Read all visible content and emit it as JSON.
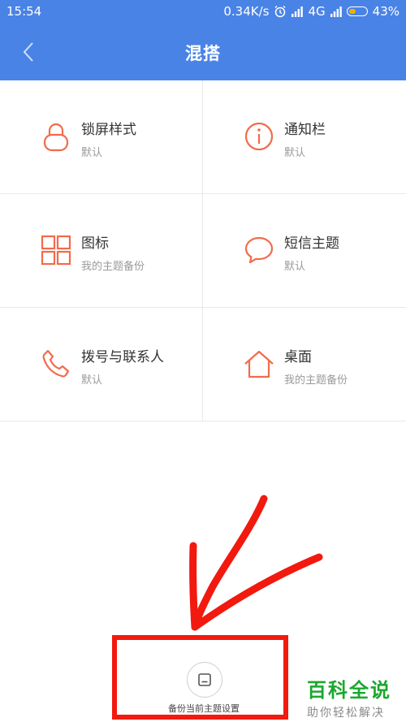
{
  "status_bar": {
    "time": "15:54",
    "speed": "0.34K/s",
    "network": "4G",
    "battery": "43%",
    "battery_level": 0.43
  },
  "header": {
    "title": "混搭",
    "background": "#4a83e6"
  },
  "items": [
    {
      "label": "锁屏样式",
      "sub": "默认",
      "icon": "lock-icon"
    },
    {
      "label": "通知栏",
      "sub": "默认",
      "icon": "info-icon"
    },
    {
      "label": "图标",
      "sub": "我的主题备份",
      "icon": "grid-icon"
    },
    {
      "label": "短信主题",
      "sub": "默认",
      "icon": "chat-bubble-icon"
    },
    {
      "label": "拨号与联系人",
      "sub": "默认",
      "icon": "phone-icon"
    },
    {
      "label": "桌面",
      "sub": "我的主题备份",
      "icon": "home-icon"
    }
  ],
  "accent_color": "#f26b4a",
  "annotation_color": "#f2190f",
  "backup": {
    "label": "备份当前主题设置",
    "icon": "save-icon"
  },
  "watermark": {
    "main": "百科全说",
    "sub": "助你轻松解决",
    "color": "#1aa82e"
  }
}
